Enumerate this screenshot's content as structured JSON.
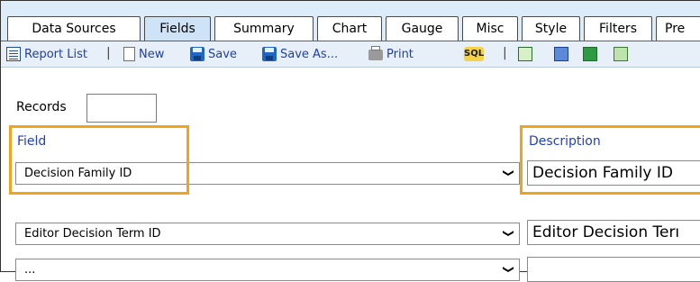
{
  "tabs": [
    {
      "label": "Data Sources"
    },
    {
      "label": "Fields",
      "active": true
    },
    {
      "label": "Summary"
    },
    {
      "label": "Chart"
    },
    {
      "label": "Gauge"
    },
    {
      "label": "Misc"
    },
    {
      "label": "Style"
    },
    {
      "label": "Filters"
    },
    {
      "label": "Pre"
    }
  ],
  "toolbar": {
    "report_list": "Report List",
    "new": "New",
    "save": "Save",
    "save_as": "Save As...",
    "print": "Print",
    "sql_icon_text": "SQL"
  },
  "records": {
    "label": "Records",
    "value": ""
  },
  "columns": {
    "field": "Field",
    "description": "Description"
  },
  "rows": [
    {
      "field": "Decision Family ID",
      "description": "Decision Family ID"
    },
    {
      "field": "Editor Decision Term ID",
      "description": "Editor Decision Terı"
    },
    {
      "field": "...",
      "description": ""
    }
  ],
  "colors": {
    "highlight": "#f0a41c",
    "tab_bar": "#dcecf8",
    "toolbar": "#e7f0f9",
    "link": "#1f3fc4"
  },
  "icons": [
    "report-list-icon",
    "new-page-icon",
    "save-icon",
    "save-as-icon",
    "print-icon",
    "sql-icon",
    "export-icon",
    "edit-icon",
    "excel-icon",
    "excel-export-icon"
  ]
}
